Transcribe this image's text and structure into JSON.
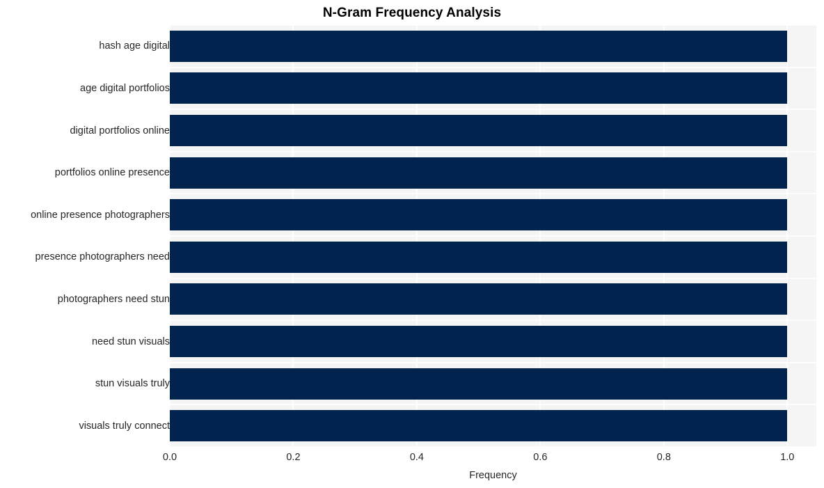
{
  "chart_data": {
    "type": "bar",
    "orientation": "horizontal",
    "title": "N-Gram Frequency Analysis",
    "xlabel": "Frequency",
    "ylabel": "",
    "categories": [
      "hash age digital",
      "age digital portfolios",
      "digital portfolios online",
      "portfolios online presence",
      "online presence photographers",
      "presence photographers need",
      "photographers need stun",
      "need stun visuals",
      "stun visuals truly",
      "visuals truly connect"
    ],
    "values": [
      1.0,
      1.0,
      1.0,
      1.0,
      1.0,
      1.0,
      1.0,
      1.0,
      1.0,
      1.0
    ],
    "xticks": [
      "0.0",
      "0.2",
      "0.4",
      "0.6",
      "0.8",
      "1.0"
    ],
    "xtick_values": [
      0.0,
      0.2,
      0.4,
      0.6,
      0.8,
      1.0
    ],
    "xlim": [
      0.0,
      1.047
    ],
    "grid": true,
    "legend": false,
    "bar_color": "#01244e",
    "plot_background": "#f5f5f6",
    "grid_color": "#fdfdfe",
    "figure_background": "#ffffff",
    "text_color": "#262626"
  }
}
